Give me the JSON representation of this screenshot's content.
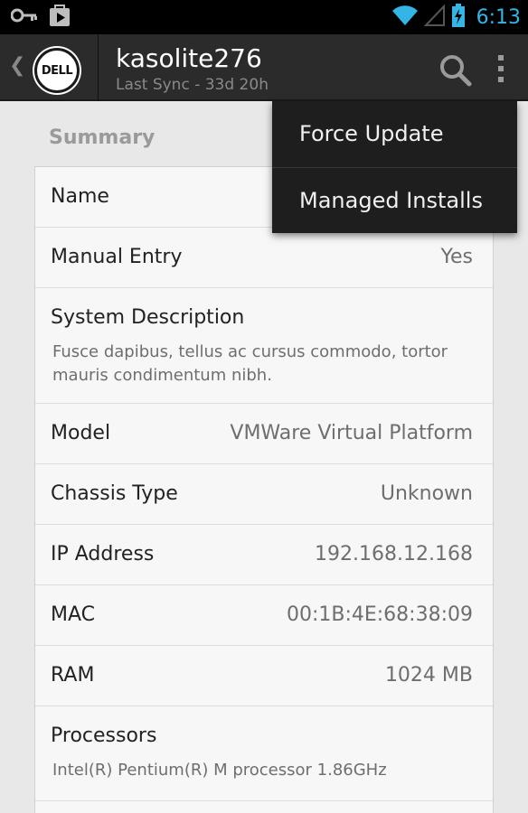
{
  "status_bar": {
    "time": "6:13",
    "icons": [
      "key-icon",
      "play-store-icon",
      "wifi-icon",
      "signal-icon",
      "battery-charging-icon"
    ],
    "accent_color": "#33b5e5"
  },
  "action_bar": {
    "logo_text": "DELL",
    "title": "kasolite276",
    "subtitle": "Last Sync - 33d 20h",
    "icons": [
      "back-chevron-icon",
      "search-icon",
      "overflow-menu-icon"
    ]
  },
  "summary": {
    "header": "Summary",
    "rows": [
      {
        "label": "Name",
        "value": ""
      },
      {
        "label": "Manual Entry",
        "value": "Yes"
      },
      {
        "label": "System Description",
        "description": "Fusce dapibus, tellus ac cursus commodo, tortor mauris condimentum nibh."
      },
      {
        "label": "Model",
        "value": "VMWare Virtual Platform"
      },
      {
        "label": "Chassis Type",
        "value": "Unknown"
      },
      {
        "label": "IP Address",
        "value": "192.168.12.168"
      },
      {
        "label": "MAC",
        "value": "00:1B:4E:68:38:09"
      },
      {
        "label": "RAM",
        "value": "1024 MB"
      },
      {
        "label": "Processors",
        "description": "Intel(R) Pentium(R) M processor 1.86GHz"
      }
    ]
  },
  "overflow_menu": {
    "items": [
      "Force Update",
      "Managed Installs"
    ]
  }
}
